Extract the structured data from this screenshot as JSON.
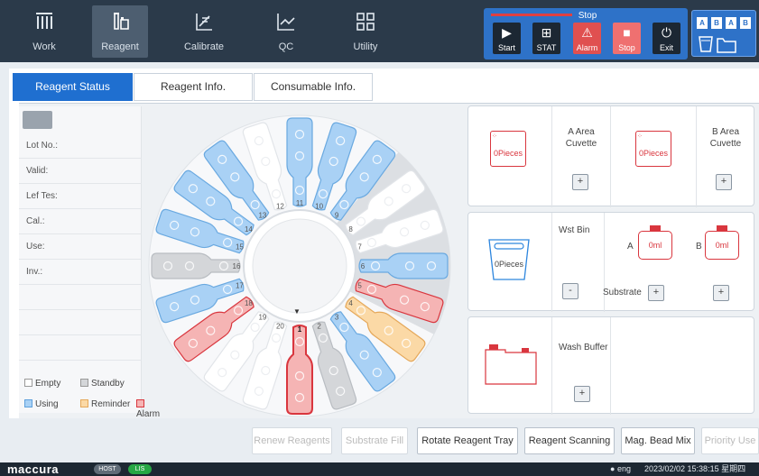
{
  "nav": {
    "items": [
      {
        "label": "Work",
        "icon": "work-icon"
      },
      {
        "label": "Reagent",
        "icon": "reagent-icon",
        "active": true
      },
      {
        "label": "Calibrate",
        "icon": "calibrate-icon"
      },
      {
        "label": "QC",
        "icon": "qc-icon"
      },
      {
        "label": "Utility",
        "icon": "utility-icon"
      }
    ]
  },
  "control": {
    "status": "Stop",
    "buttons": [
      {
        "label": "Start",
        "icon": "play-icon",
        "glyph": "▶"
      },
      {
        "label": "STAT",
        "icon": "stat-plus-icon",
        "glyph": "⊞"
      },
      {
        "label": "Alarm",
        "icon": "alarm-icon",
        "glyph": "⚠"
      },
      {
        "label": "Stop",
        "icon": "stop-icon",
        "glyph": "■"
      },
      {
        "label": "Exit",
        "icon": "power-icon",
        "glyph": "⏻"
      }
    ]
  },
  "sensors": {
    "labels": [
      "A",
      "B",
      "A",
      "B"
    ]
  },
  "tabs": [
    "Reagent Status",
    "Reagent Info.",
    "Consumable Info."
  ],
  "info": {
    "fields": [
      "Lot No.:",
      "Valid:",
      "Lef Tes:",
      "Cal.:",
      "Use:",
      "Inv.:"
    ]
  },
  "legend": {
    "empty": "Empty",
    "standby": "Standby",
    "using": "Using",
    "reminder": "Reminder",
    "alarm": "Alarm"
  },
  "tray": {
    "positions": [
      "1",
      "2",
      "3",
      "4",
      "5",
      "6",
      "7",
      "8",
      "9",
      "10",
      "11",
      "12",
      "13",
      "14",
      "15",
      "16",
      "17",
      "18",
      "19",
      "20"
    ]
  },
  "consumables": {
    "a_area_label": "A Area\nCuvette",
    "a_area_line1": "A Area",
    "a_area_line2": "Cuvette",
    "a_area_value": "0Pieces",
    "b_area_line1": "B Area",
    "b_area_line2": "Cuvette",
    "b_area_value": "0Pieces",
    "wst_bin_label": "Wst Bin",
    "wst_bin_value": "0Pieces",
    "substrate_a_label": "A",
    "substrate_a_value": "0ml",
    "substrate_b_label": "B",
    "substrate_b_value": "0ml",
    "substrate_label": "Substrate",
    "wash_buffer_label": "Wash Buffer",
    "plus": "+",
    "minus": "-"
  },
  "actions": [
    {
      "label": "Renew Reagents",
      "enabled": false
    },
    {
      "label": "Substrate Fill",
      "enabled": false
    },
    {
      "label": "Rotate Reagent Tray",
      "enabled": true
    },
    {
      "label": "Reagent Scanning",
      "enabled": true
    },
    {
      "label": "Mag. Bead Mix",
      "enabled": true
    },
    {
      "label": "Priority Use",
      "enabled": false
    }
  ],
  "statusbar": {
    "brand": "maccura",
    "host": "HOST",
    "lis": "LIS",
    "user": "eng",
    "datetime": "2023/02/02 15:38:15 星期四"
  },
  "colors": {
    "accent": "#1f6fd0",
    "using": "#a9d1f5",
    "reminder": "#fbd9a6",
    "alarm": "#f5b4b4",
    "standby": "#d4d6d9",
    "alarm_border": "#d9363e"
  }
}
